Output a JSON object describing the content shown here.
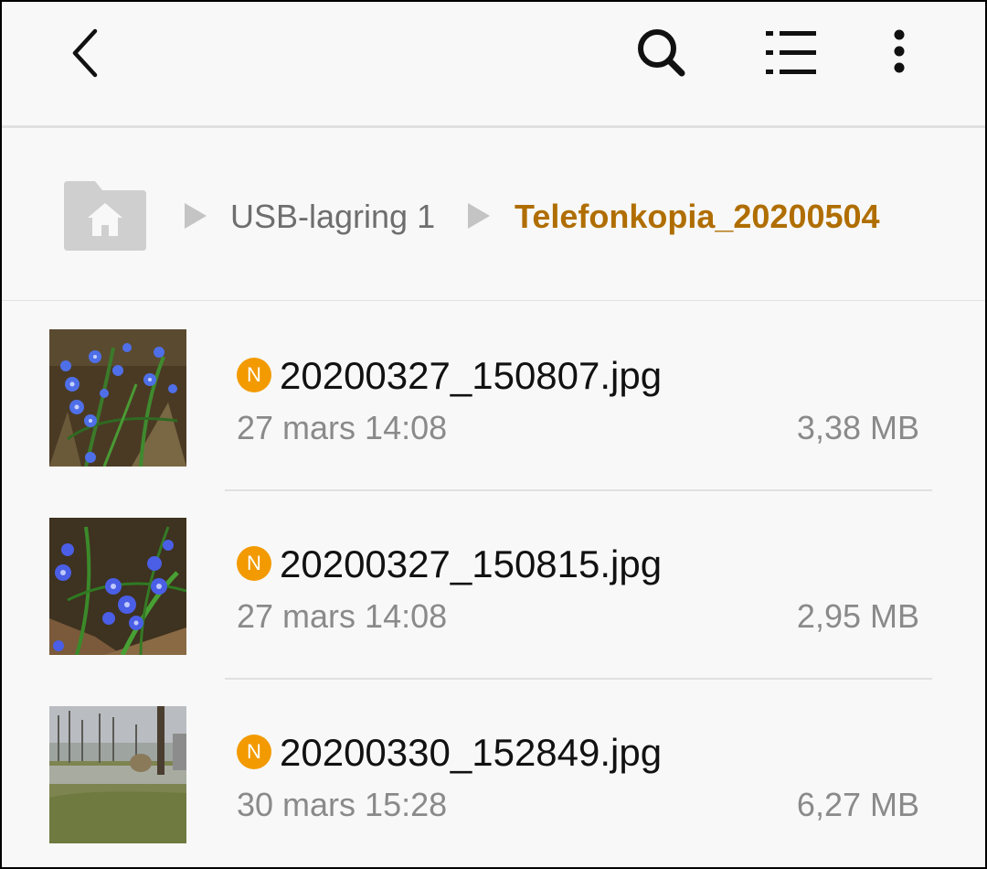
{
  "toolbar": {
    "back_icon": "chevron-left-icon",
    "search_icon": "search-icon",
    "list_view_icon": "list-view-icon",
    "more_icon": "more-vertical-icon"
  },
  "breadcrumb": {
    "home_icon": "home-folder-icon",
    "items": [
      {
        "label": "USB-lagring 1"
      },
      {
        "label": "Telefonkopia_20200504"
      }
    ],
    "active_color": "#b06e00"
  },
  "files": [
    {
      "badge": "N",
      "name": "20200327_150807.jpg",
      "date": "27 mars 14:08",
      "size": "3,38 MB"
    },
    {
      "badge": "N",
      "name": "20200327_150815.jpg",
      "date": "27 mars 14:08",
      "size": "2,95 MB"
    },
    {
      "badge": "N",
      "name": "20200330_152849.jpg",
      "date": "30 mars 15:28",
      "size": "6,27 MB"
    }
  ],
  "colors": {
    "badge": "#f29a00",
    "background": "#f8f8f8"
  }
}
